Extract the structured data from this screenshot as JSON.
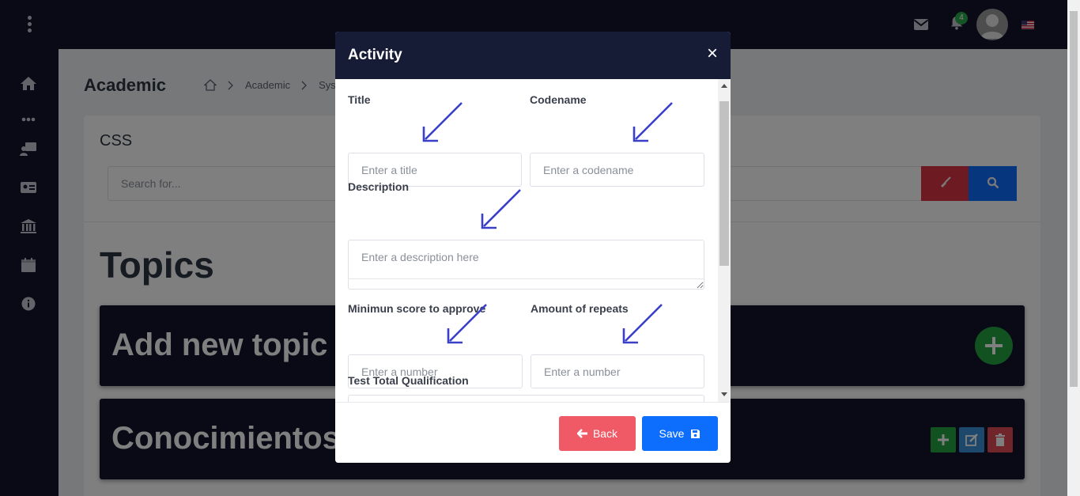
{
  "topbar": {
    "notification_count": "4"
  },
  "page": {
    "title": "Academic",
    "breadcrumb": [
      "Academic",
      "Sys"
    ],
    "card_title": "CSS",
    "search_placeholder": "Search for...",
    "topics_heading": "Topics",
    "topics": [
      {
        "label": "Add new topic"
      },
      {
        "label": "Conocimientos I"
      }
    ]
  },
  "modal": {
    "title": "Activity",
    "close_label": "×",
    "fields": {
      "title": {
        "label": "Title",
        "placeholder": "Enter a title"
      },
      "codename": {
        "label": "Codename",
        "placeholder": "Enter a codename"
      },
      "description": {
        "label": "Description",
        "placeholder": "Enter a description here"
      },
      "min_score": {
        "label": "Minimun score to approve",
        "placeholder": "Enter a number"
      },
      "repeats": {
        "label": "Amount of repeats",
        "placeholder": "Enter a number"
      },
      "test_total": {
        "label": "Test Total Qualification"
      }
    },
    "back_label": "Back",
    "save_label": "Save"
  },
  "colors": {
    "dark_navy": "#13152b",
    "modal_header": "#161b36",
    "primary": "#0d6efd",
    "danger": "#f05a67",
    "success": "#22a541",
    "annotation_arrow": "#3a3fc8"
  }
}
